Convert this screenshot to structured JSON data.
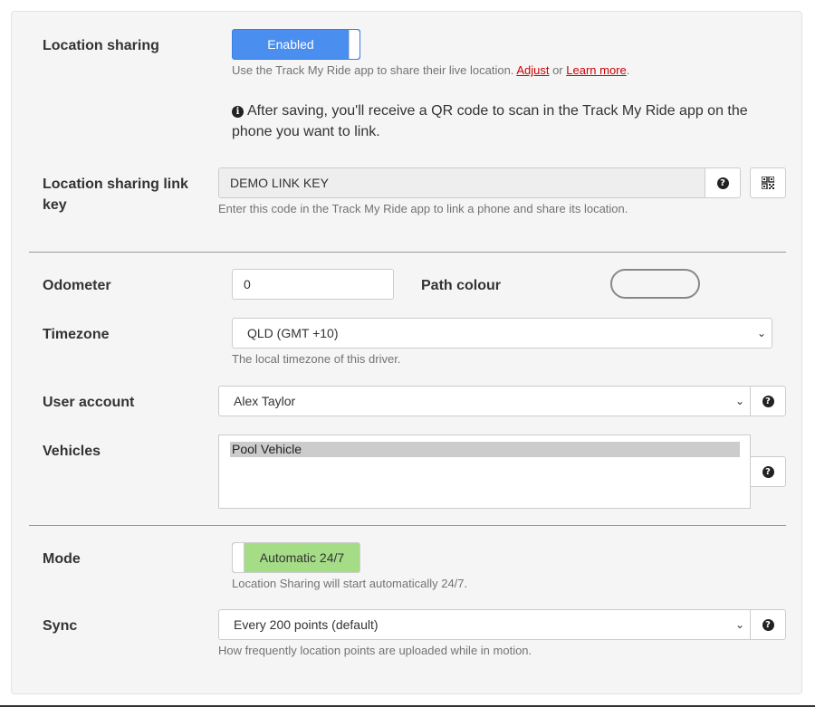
{
  "location_sharing": {
    "label": "Location sharing",
    "toggle_label": "Enabled",
    "help_prefix": "Use the Track My Ride app to share their live location. ",
    "adjust_link": "Adjust",
    "help_or": " or ",
    "learn_more_link": "Learn more",
    "help_suffix": ".",
    "info_icon_text": "i",
    "info_text": "After saving, you'll receive a QR code to scan in the Track My Ride app on the phone you want to link."
  },
  "link_key": {
    "label": "Location sharing link key",
    "value": "DEMO LINK KEY",
    "help_icon": "question-circle-icon",
    "qr_icon": "qr-code-icon",
    "help": "Enter this code in the Track My Ride app to link a phone and share its location."
  },
  "odometer": {
    "label": "Odometer",
    "value": "0"
  },
  "path_colour": {
    "label": "Path colour"
  },
  "timezone": {
    "label": "Timezone",
    "selected": "QLD (GMT +10)",
    "help": "The local timezone of this driver."
  },
  "user_account": {
    "label": "User account",
    "selected": "Alex Taylor"
  },
  "vehicles": {
    "label": "Vehicles",
    "options": [
      "Pool Vehicle"
    ]
  },
  "mode": {
    "label": "Mode",
    "toggle_label": "Automatic 24/7",
    "help": "Location Sharing will start automatically 24/7."
  },
  "sync": {
    "label": "Sync",
    "selected": "Every 200 points (default)",
    "help": "How frequently location points are uploaded while in motion."
  },
  "icons": {
    "chevron": "chevron-down-icon",
    "question_glyph": "?"
  }
}
